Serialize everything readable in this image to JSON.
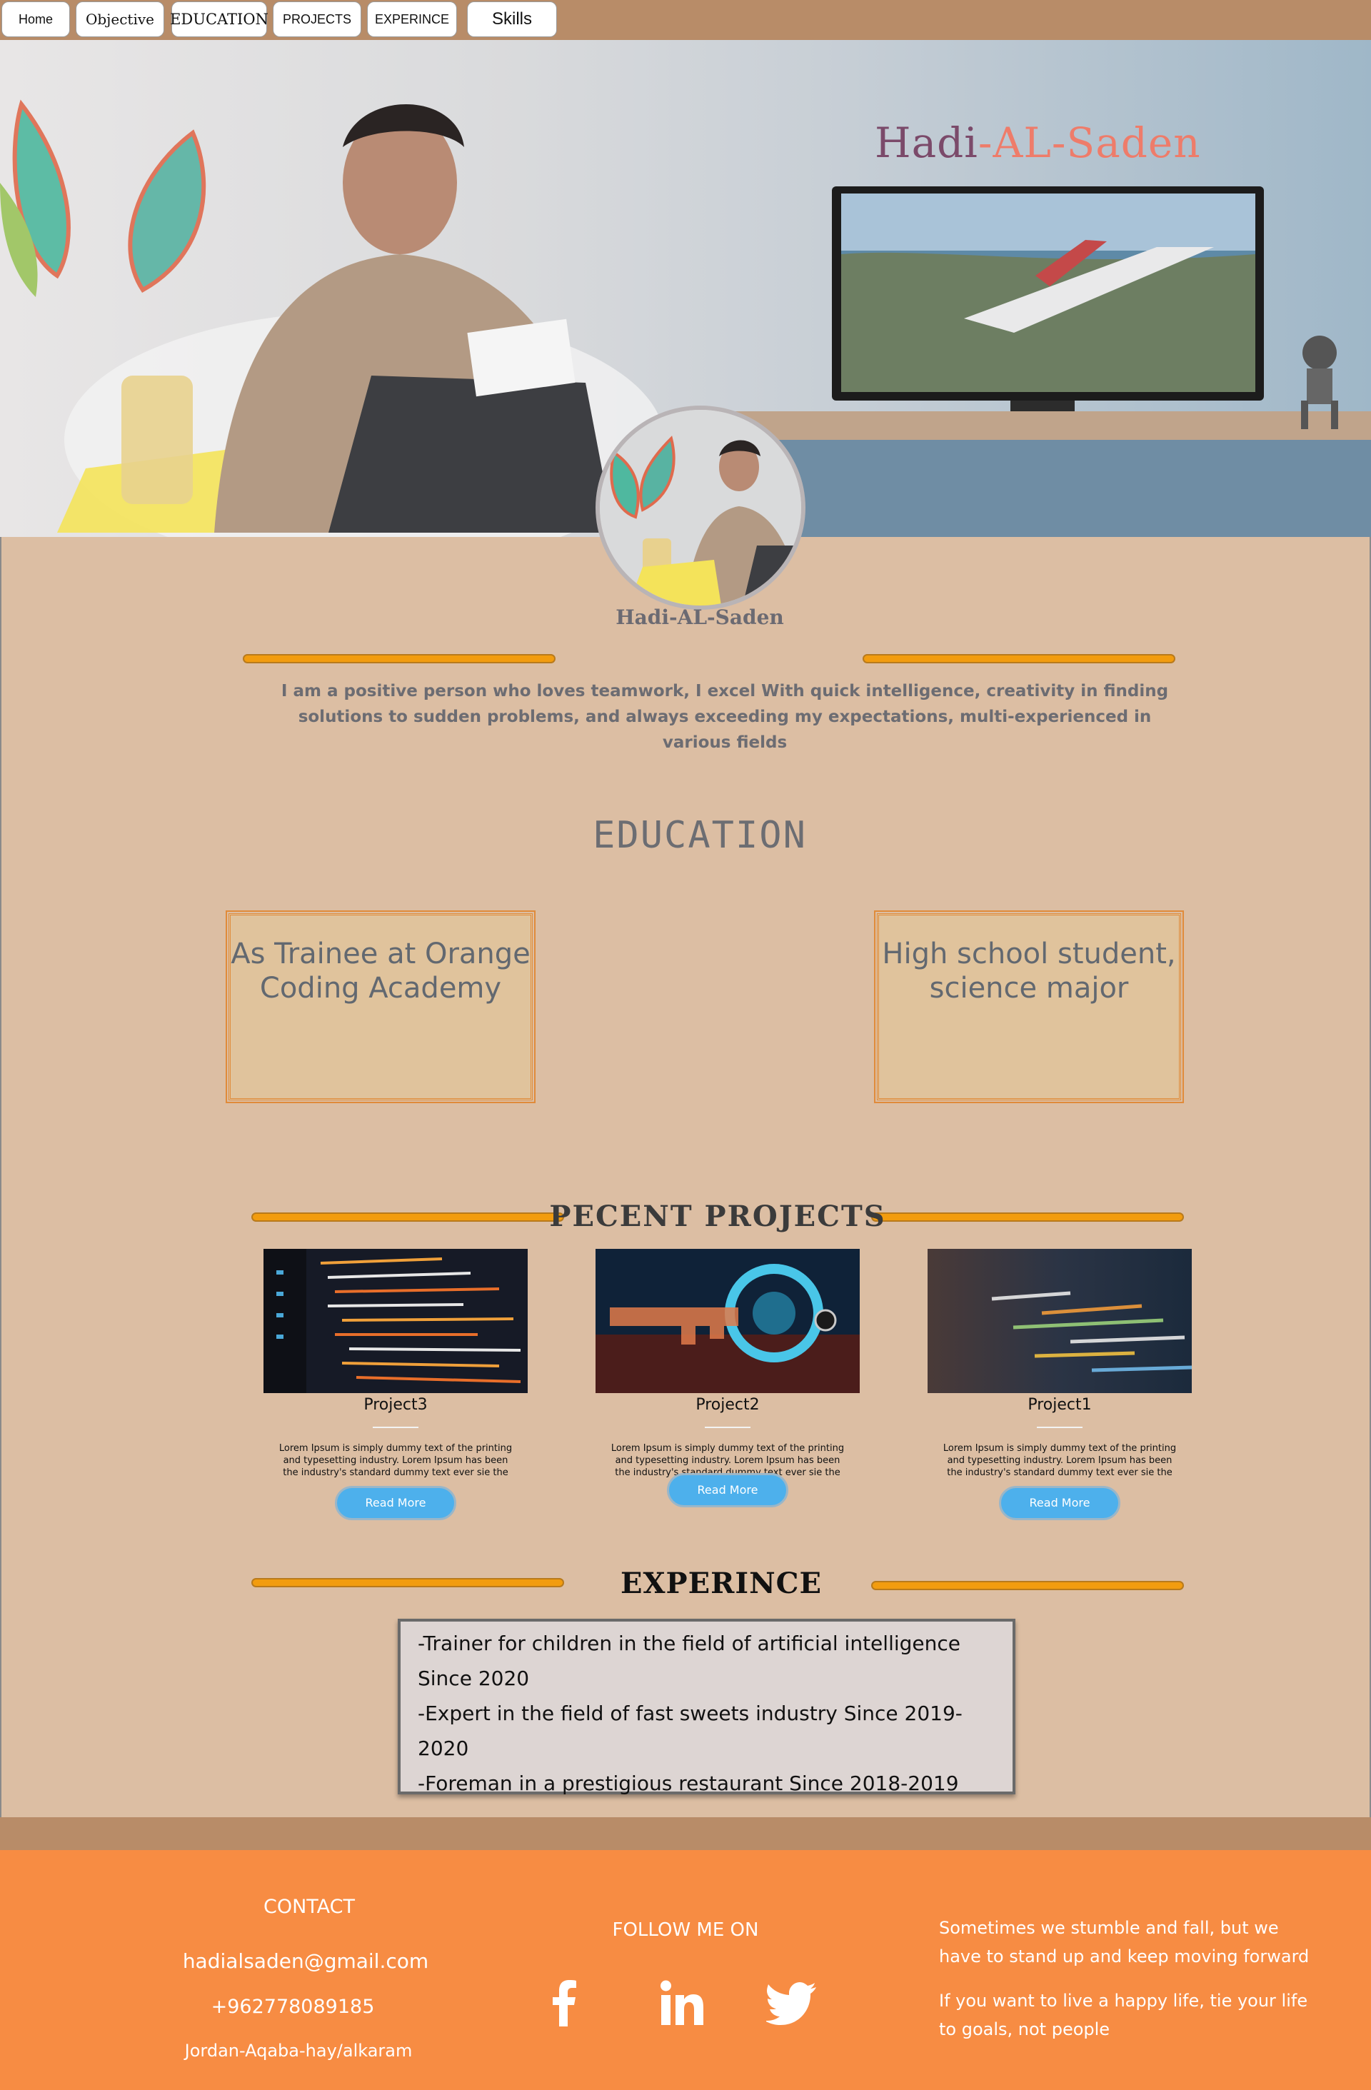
{
  "nav": {
    "items": [
      {
        "label": "Home"
      },
      {
        "label": "Objective"
      },
      {
        "label": "EDUCATION"
      },
      {
        "label": "PROJECTS"
      },
      {
        "label": "EXPERINCE"
      },
      {
        "label": "Skills"
      }
    ]
  },
  "hero": {
    "title_part1": "Hadi",
    "title_sep": "-",
    "title_part2": "AL",
    "title_sep2": "-",
    "title_part3": "Saden"
  },
  "profile": {
    "name": "Hadi-AL-Saden",
    "bio": "I am a positive person who loves teamwork, I excel  With quick intelligence, creativity in finding solutions to sudden problems, and always exceeding my expectations, multi-experienced in various fields"
  },
  "education": {
    "title": "EDUCATION",
    "items": [
      {
        "text": "As Trainee at Orange Coding Academy"
      },
      {
        "text": "High school student, science major"
      }
    ]
  },
  "projects": {
    "title": "PECENT  PROJECTS",
    "items": [
      {
        "title": "Project3",
        "desc": "Lorem Ipsum is simply dummy text of the printing and typesetting industry. Lorem Ipsum has been the industry's standard dummy text ever sie the",
        "button": "Read More"
      },
      {
        "title": "Project2",
        "desc": "Lorem Ipsum is simply dummy text of the printing and typesetting industry. Lorem Ipsum has been the industry's standard dummy text ever sie the",
        "button": "Read More"
      },
      {
        "title": "Project1",
        "desc": "Lorem Ipsum is simply dummy text of the printing and typesetting industry. Lorem Ipsum has been the industry's standard dummy text ever sie the",
        "button": "Read More"
      }
    ]
  },
  "experience": {
    "title": "EXPERINCE",
    "lines": [
      "-Trainer for children in the field of artificial intelligence",
      "Since 2020",
      "-Expert in the field of fast sweets industry Since 2019-2020",
      "-Foreman in a prestigious restaurant Since 2018-2019"
    ]
  },
  "footer": {
    "contact_title": "CONTACT",
    "email": "hadialsaden@gmail.com",
    "phone": "+962778089185",
    "address": "Jordan-Aqaba-hay/alkaram",
    "follow_title": "FOLLOW ME ON",
    "social": [
      "facebook-icon",
      "linkedin-icon",
      "twitter-icon"
    ],
    "quote1": "Sometimes we stumble and fall, but we have to stand up and keep moving forward",
    "quote2": "If you want to live a happy life, tie your life to goals, not people"
  },
  "colors": {
    "nav_bg": "#b88c68",
    "page_bg": "#dcbea3",
    "accent_bar": "#f29c0f",
    "footer_bg": "#f78c43",
    "button": "#4db0ec"
  }
}
